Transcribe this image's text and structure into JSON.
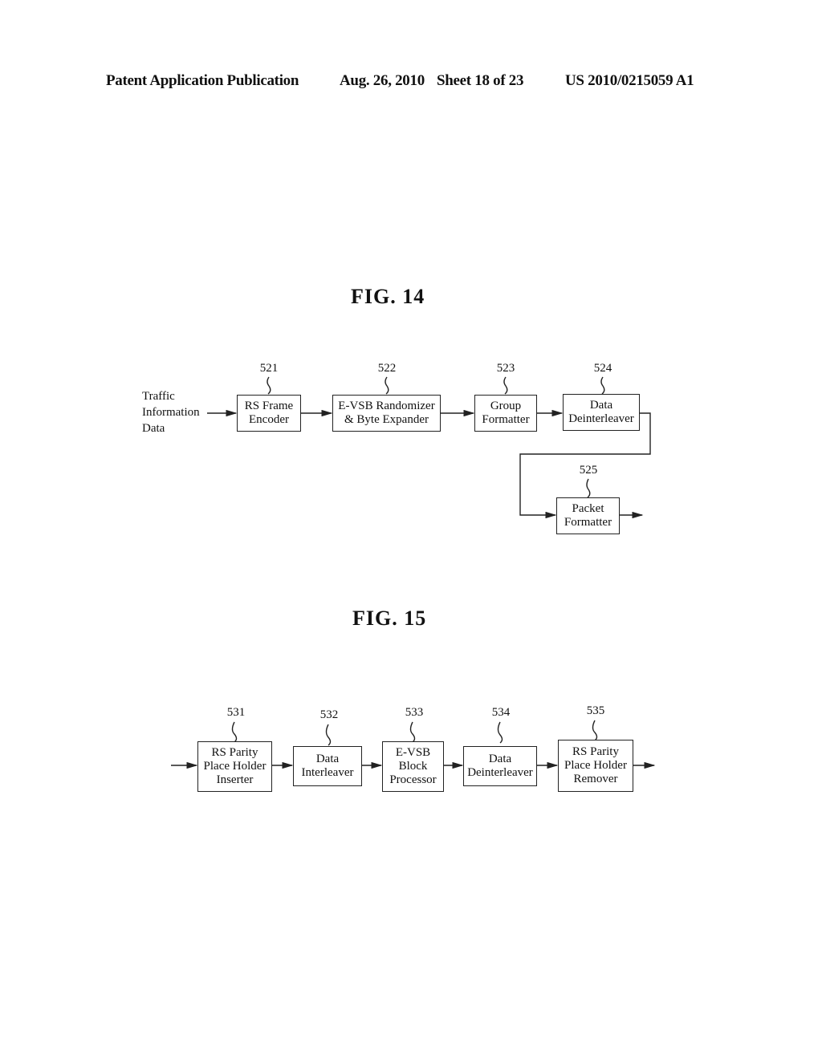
{
  "header": {
    "left": "Patent Application Publication",
    "date": "Aug. 26, 2010",
    "sheet": "Sheet 18 of 23",
    "number": "US 2010/0215059 A1"
  },
  "fig14": {
    "title": "FIG. 14",
    "input_label": [
      "Traffic",
      "Information",
      "Data"
    ],
    "blocks": [
      {
        "ref": "521",
        "lines": [
          "RS Frame",
          "Encoder"
        ]
      },
      {
        "ref": "522",
        "lines": [
          "E-VSB Randomizer",
          "& Byte Expander"
        ]
      },
      {
        "ref": "523",
        "lines": [
          "Group",
          "Formatter"
        ]
      },
      {
        "ref": "524",
        "lines": [
          "Data",
          "Deinterleaver"
        ]
      },
      {
        "ref": "525",
        "lines": [
          "Packet",
          "Formatter"
        ]
      }
    ]
  },
  "fig15": {
    "title": "FIG. 15",
    "blocks": [
      {
        "ref": "531",
        "lines": [
          "RS Parity",
          "Place Holder",
          "Inserter"
        ]
      },
      {
        "ref": "532",
        "lines": [
          "Data",
          "Interleaver"
        ]
      },
      {
        "ref": "533",
        "lines": [
          "E-VSB",
          "Block",
          "Processor"
        ]
      },
      {
        "ref": "534",
        "lines": [
          "Data",
          "Deinterleaver"
        ]
      },
      {
        "ref": "535",
        "lines": [
          "RS Parity",
          "Place Holder",
          "Remover"
        ]
      }
    ]
  }
}
